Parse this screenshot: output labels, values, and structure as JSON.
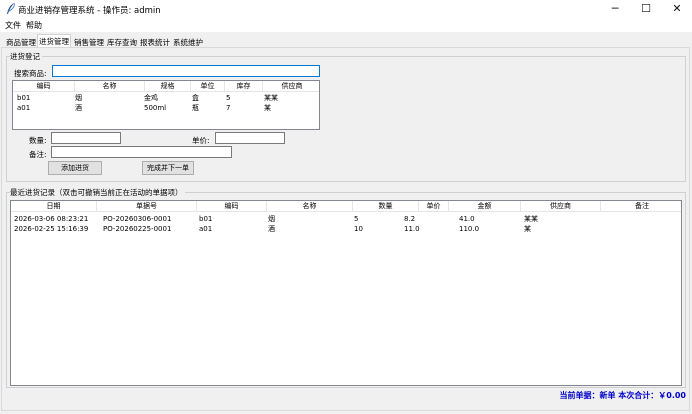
{
  "window": {
    "title": "商业进销存管理系统 - 操作员: admin",
    "controls": {
      "minimize": "─",
      "maximize": "☐",
      "close": "✕"
    }
  },
  "menu": [
    "文件",
    "帮助"
  ],
  "tabs": [
    "商品管理",
    "进货管理",
    "销售管理",
    "库存查询",
    "报表统计",
    "系统维护"
  ],
  "active_tab": "进货管理",
  "entry": {
    "group_title": "进货登记",
    "search_label": "搜索商品:",
    "search_value": "",
    "product_columns": [
      "编码",
      "名称",
      "规格",
      "单位",
      "库存",
      "供应商"
    ],
    "products": [
      [
        "b01",
        "烟",
        "金鸡",
        "盒",
        "5",
        "某某"
      ],
      [
        "a01",
        "酒",
        "500ml",
        "瓶",
        "7",
        "某"
      ]
    ],
    "qty_label": "数量:",
    "qty_value": "",
    "price_label": "单价:",
    "price_value": "",
    "note_label": "备注:",
    "note_value": "",
    "add_button": "添加进货",
    "finish_button": "完成并下一单"
  },
  "recent": {
    "group_title": "最近进货记录（双击可撤销当前正在活动的单据项）",
    "columns": [
      "日期",
      "单据号",
      "编码",
      "名称",
      "数量",
      "单价",
      "金额",
      "供应商",
      "备注"
    ],
    "rows": [
      [
        "2026-03-06 08:23:21",
        "PO-20260306-0001",
        "b01",
        "烟",
        "5",
        "8.2",
        "41.0",
        "某某",
        ""
      ],
      [
        "2026-02-25 15:16:39",
        "PO-20260225-0001",
        "a01",
        "酒",
        "10",
        "11.0",
        "110.0",
        "某",
        ""
      ]
    ]
  },
  "status": "当前单据：新单  本次合计：￥0.00",
  "colors": {
    "accent": "#0078d7",
    "status_text": "#0000cc"
  }
}
